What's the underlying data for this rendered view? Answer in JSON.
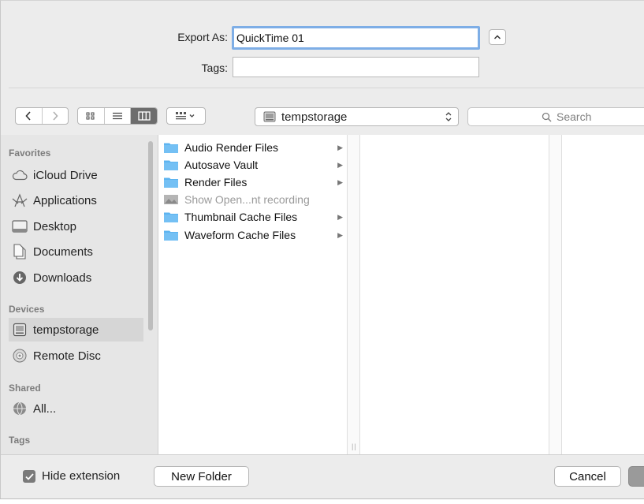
{
  "header": {
    "export_label": "Export As:",
    "export_value": "QuickTime 01",
    "tags_label": "Tags:",
    "tags_value": ""
  },
  "toolbar": {
    "back_icon": "chevron-left-icon",
    "forward_icon": "chevron-right-icon",
    "view_modes": [
      "icon-view-icon",
      "list-view-icon",
      "column-view-icon"
    ],
    "selected_view": "column-view-icon",
    "arrange_icon": "arrange-grid-icon",
    "location": "tempstorage",
    "search_placeholder": "Search"
  },
  "sidebar": {
    "favorites_heading": "Favorites",
    "favorites": [
      {
        "label": "iCloud Drive",
        "icon": "cloud-icon"
      },
      {
        "label": "Applications",
        "icon": "applications-icon"
      },
      {
        "label": "Desktop",
        "icon": "desktop-icon"
      },
      {
        "label": "Documents",
        "icon": "documents-icon"
      },
      {
        "label": "Downloads",
        "icon": "downloads-icon"
      }
    ],
    "devices_heading": "Devices",
    "devices": [
      {
        "label": "tempstorage",
        "icon": "disk-icon",
        "selected": true
      },
      {
        "label": "Remote Disc",
        "icon": "remote-disc-icon"
      }
    ],
    "shared_heading": "Shared",
    "shared": [
      {
        "label": "All...",
        "icon": "network-globe-icon"
      }
    ],
    "tags_heading": "Tags"
  },
  "files": [
    {
      "name": "Audio Render Files",
      "type": "folder",
      "has_children": true
    },
    {
      "name": "Autosave Vault",
      "type": "folder",
      "has_children": true
    },
    {
      "name": "Render Files",
      "type": "folder",
      "has_children": true
    },
    {
      "name": "Show Open...nt recording",
      "type": "file",
      "has_children": false,
      "disabled": true
    },
    {
      "name": "Thumbnail Cache Files",
      "type": "folder",
      "has_children": true
    },
    {
      "name": "Waveform Cache Files",
      "type": "folder",
      "has_children": true
    }
  ],
  "footer": {
    "hide_extension_label": "Hide extension",
    "hide_extension_checked": true,
    "new_folder_label": "New Folder",
    "cancel_label": "Cancel"
  },
  "colors": {
    "focus_ring": "#7eaee6",
    "folder_blue": "#5db4f0",
    "selected_segment": "#6d6d6d"
  }
}
